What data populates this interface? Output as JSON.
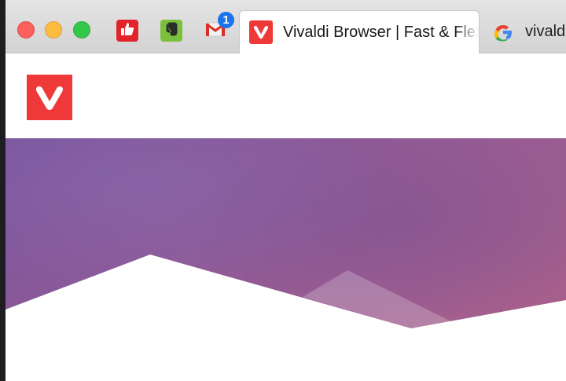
{
  "window": {
    "controls": [
      "close",
      "minimize",
      "maximize"
    ]
  },
  "pinned_tabs": [
    {
      "icon": "thumbs-up-icon"
    },
    {
      "icon": "evernote-elephant-icon"
    },
    {
      "icon": "gmail-icon",
      "badge": "1"
    }
  ],
  "tabs": [
    {
      "title": "Vivaldi Browser | Fast & Flexible Web Browser",
      "icon": "vivaldi-logo-icon",
      "active": true
    },
    {
      "title": "vivaldi",
      "icon": "google-g-icon",
      "active": false
    }
  ],
  "page": {
    "logo": "vivaldi-logo-icon",
    "hero_colors": {
      "start": "#7b559f",
      "end": "#a55f8c"
    }
  },
  "colors": {
    "vivaldi_red": "#ef3939",
    "badge_blue": "#1a73e8"
  }
}
